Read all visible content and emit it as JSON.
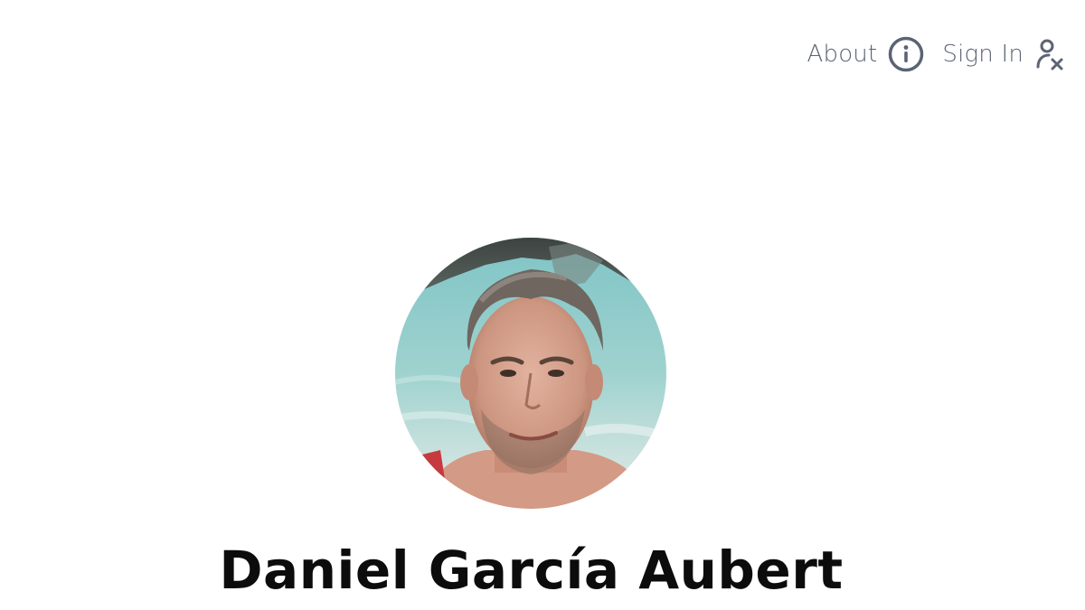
{
  "nav": {
    "about_label": "About",
    "about_icon": "info-icon",
    "signin_label": "Sign In",
    "signin_icon": "user-x-icon"
  },
  "profile": {
    "name": "Daniel García Aubert",
    "avatar_alt": "profile-photo"
  },
  "colors": {
    "nav_text": "#5b6374",
    "name_text": "#0c0c0c",
    "background": "#ffffff"
  }
}
